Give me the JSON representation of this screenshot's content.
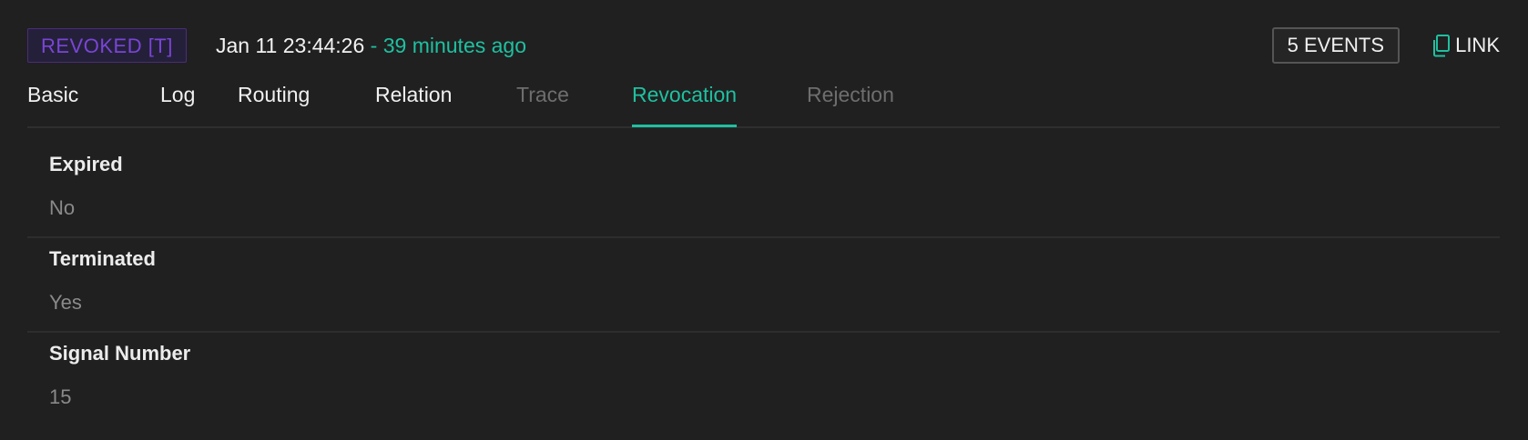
{
  "header": {
    "status_badge": "REVOKED [T]",
    "timestamp": "Jan 11 23:44:26",
    "separator": "- ",
    "relative_time": "39 minutes ago",
    "events_button": "5 EVENTS",
    "link_button": "LINK"
  },
  "tabs": [
    {
      "label": "Basic",
      "state": "normal"
    },
    {
      "label": "Log",
      "state": "normal"
    },
    {
      "label": "Routing",
      "state": "normal"
    },
    {
      "label": "Relation",
      "state": "normal"
    },
    {
      "label": "Trace",
      "state": "disabled"
    },
    {
      "label": "Revocation",
      "state": "active"
    },
    {
      "label": "Rejection",
      "state": "disabled"
    }
  ],
  "fields": [
    {
      "label": "Expired",
      "value": "No"
    },
    {
      "label": "Terminated",
      "value": "Yes"
    },
    {
      "label": "Signal Number",
      "value": "15"
    }
  ],
  "colors": {
    "background": "#202020",
    "accent": "#1fc0a0",
    "revoked": "#7a45d6",
    "muted": "#8a8a8a"
  },
  "icons": {
    "link": "copy-icon"
  }
}
